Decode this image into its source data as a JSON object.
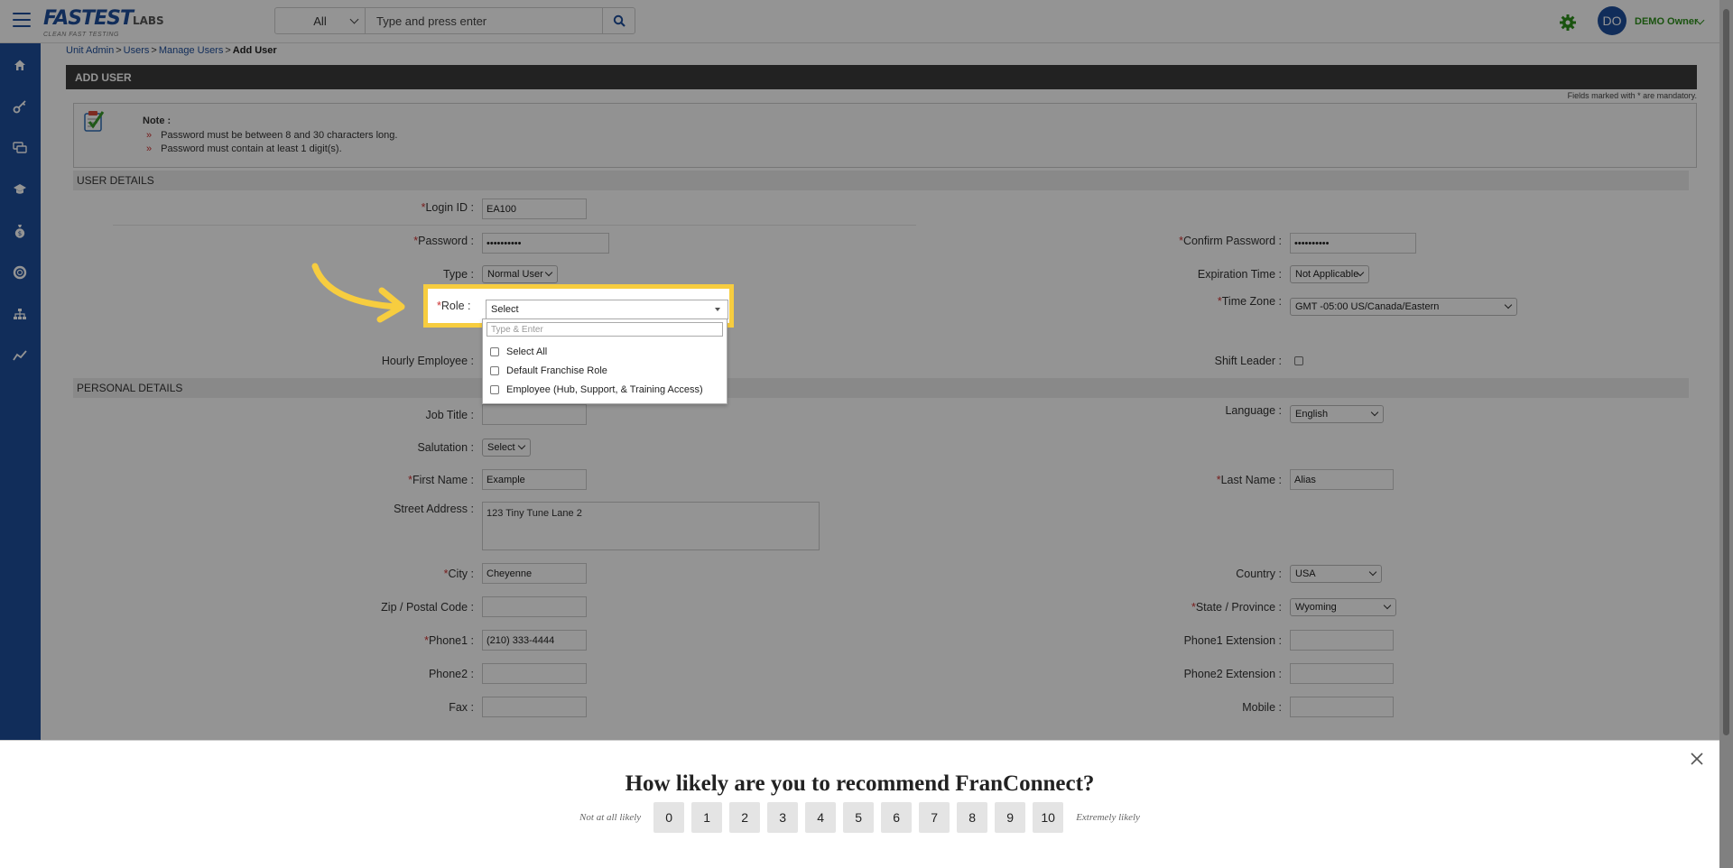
{
  "header": {
    "logo_main": "FASTEST",
    "logo_labs": "LABS",
    "logo_tagline": "CLEAN FAST TESTING",
    "search_scope": "All",
    "search_placeholder": "Type and press enter",
    "user_initials": "DO",
    "user_name": "DEMO Owner"
  },
  "breadcrumb": [
    {
      "label": "Unit Admin"
    },
    {
      "label": "Users"
    },
    {
      "label": "Manage Users"
    }
  ],
  "breadcrumb_current": "Add User",
  "breadcrumb_separator": ">",
  "page_title": "ADD USER",
  "mandatory_note": "Fields marked with * are mandatory.",
  "note": {
    "title": "Note :",
    "lines": [
      "Password must be between 8 and 30 characters long.",
      "Password must contain at least 1 digit(s)."
    ]
  },
  "sections": {
    "user_details": "USER DETAILS",
    "personal_details": "PERSONAL DETAILS"
  },
  "fields": {
    "login_id": {
      "label": "Login ID :",
      "value": "EA100"
    },
    "password": {
      "label": "Password :",
      "value": "••••••••••"
    },
    "confirm_password": {
      "label": "Confirm Password :",
      "value": "••••••••••"
    },
    "type": {
      "label": "Type :",
      "value": "Normal User"
    },
    "expiration_time": {
      "label": "Expiration Time :",
      "value": "Not Applicable"
    },
    "role": {
      "label": "Role :",
      "value": "Select"
    },
    "time_zone": {
      "label": "Time Zone :",
      "value": "GMT -05:00 US/Canada/Eastern"
    },
    "hourly_employee": {
      "label": "Hourly Employee :"
    },
    "shift_leader": {
      "label": "Shift Leader :"
    },
    "job_title": {
      "label": "Job Title :",
      "value": ""
    },
    "language": {
      "label": "Language :",
      "value": "English"
    },
    "salutation": {
      "label": "Salutation :",
      "value": "Select"
    },
    "first_name": {
      "label": "First Name :",
      "value": "Example"
    },
    "last_name": {
      "label": "Last Name :",
      "value": "Alias"
    },
    "street_address": {
      "label": "Street Address :",
      "value": "123 Tiny Tune Lane 2"
    },
    "city": {
      "label": "City :",
      "value": "Cheyenne"
    },
    "country": {
      "label": "Country :",
      "value": "USA"
    },
    "zip": {
      "label": "Zip / Postal Code :",
      "value": ""
    },
    "state": {
      "label": "State / Province :",
      "value": "Wyoming"
    },
    "phone1": {
      "label": "Phone1 :",
      "value": "(210) 333-4444"
    },
    "phone1_ext": {
      "label": "Phone1 Extension :",
      "value": ""
    },
    "phone2": {
      "label": "Phone2 :",
      "value": ""
    },
    "phone2_ext": {
      "label": "Phone2 Extension :",
      "value": ""
    },
    "fax": {
      "label": "Fax :",
      "value": ""
    },
    "mobile": {
      "label": "Mobile :",
      "value": ""
    }
  },
  "required_mark": "*",
  "role_dropdown": {
    "search_placeholder": "Type & Enter",
    "options": [
      "Select All",
      "Default Franchise Role",
      "Employee (Hub, Support, & Training Access)"
    ]
  },
  "survey": {
    "question": "How likely are you to recommend FranConnect?",
    "low_label": "Not at all likely",
    "high_label": "Extremely likely",
    "scale": [
      "0",
      "1",
      "2",
      "3",
      "4",
      "5",
      "6",
      "7",
      "8",
      "9",
      "10"
    ]
  },
  "colors": {
    "brand_blue": "#1e4e9b",
    "highlight_yellow": "#f7cd3f",
    "user_green": "#2d8f1b",
    "required_red": "#cc3333"
  },
  "icons": {
    "nav": [
      "home-icon",
      "key-icon",
      "chat-icon",
      "graduation-cap-icon",
      "money-bag-icon",
      "lifebuoy-icon",
      "org-chart-icon",
      "trend-chart-icon"
    ]
  }
}
